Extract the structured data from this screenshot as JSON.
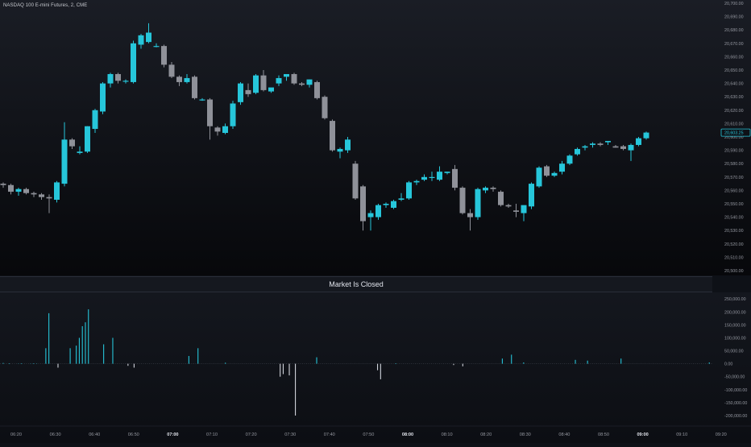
{
  "header": {
    "symbol_title": "NASDAQ 100 E-mini Futures, 2, CME"
  },
  "banner": {
    "text": "Market Is Closed"
  },
  "colors": {
    "up": "#26c6da",
    "down": "#8f9199",
    "background": "#0e1117",
    "price_tag_border": "#26c6da"
  },
  "chart_data": [
    {
      "type": "candlestick",
      "title": "",
      "ylim": [
        20500,
        20700
      ],
      "y_ticks": [
        "20,500.00",
        "20,510.00",
        "20,520.00",
        "20,530.00",
        "20,540.00",
        "20,550.00",
        "20,560.00",
        "20,570.00",
        "20,580.00",
        "20,590.00",
        "20,600.00",
        "20,610.00",
        "20,620.00",
        "20,630.00",
        "20,640.00",
        "20,650.00",
        "20,660.00",
        "20,670.00",
        "20,680.00",
        "20,690.00",
        "20,700.00"
      ],
      "last_price": 20603.25,
      "last_price_label": "20,603.25",
      "candles": [
        {
          "o": 20565,
          "h": 20566,
          "l": 20562,
          "c": 20564
        },
        {
          "o": 20564,
          "h": 20565,
          "l": 20557,
          "c": 20559
        },
        {
          "o": 20559,
          "h": 20562,
          "l": 20556,
          "c": 20561
        },
        {
          "o": 20561,
          "h": 20562,
          "l": 20557,
          "c": 20558
        },
        {
          "o": 20558,
          "h": 20559,
          "l": 20555,
          "c": 20557
        },
        {
          "o": 20557,
          "h": 20558,
          "l": 20553,
          "c": 20555
        },
        {
          "o": 20555,
          "h": 20557,
          "l": 20543,
          "c": 20554
        },
        {
          "o": 20553,
          "h": 20567,
          "l": 20551,
          "c": 20566
        },
        {
          "o": 20565,
          "h": 20611,
          "l": 20563,
          "c": 20598
        },
        {
          "o": 20598,
          "h": 20599,
          "l": 20591,
          "c": 20593
        },
        {
          "o": 20588,
          "h": 20593,
          "l": 20587,
          "c": 20589
        },
        {
          "o": 20589,
          "h": 20608,
          "l": 20588,
          "c": 20608
        },
        {
          "o": 20606,
          "h": 20621,
          "l": 20603,
          "c": 20620
        },
        {
          "o": 20619,
          "h": 20641,
          "l": 20617,
          "c": 20640
        },
        {
          "o": 20640,
          "h": 20648,
          "l": 20637,
          "c": 20647
        },
        {
          "o": 20647,
          "h": 20648,
          "l": 20640,
          "c": 20642
        },
        {
          "o": 20642,
          "h": 20643,
          "l": 20640,
          "c": 20642
        },
        {
          "o": 20641,
          "h": 20672,
          "l": 20640,
          "c": 20670
        },
        {
          "o": 20669,
          "h": 20677,
          "l": 20666,
          "c": 20676
        },
        {
          "o": 20671,
          "h": 20685,
          "l": 20670,
          "c": 20678
        },
        {
          "o": 20668,
          "h": 20670,
          "l": 20667,
          "c": 20668
        },
        {
          "o": 20668,
          "h": 20669,
          "l": 20652,
          "c": 20654
        },
        {
          "o": 20654,
          "h": 20656,
          "l": 20644,
          "c": 20645
        },
        {
          "o": 20645,
          "h": 20646,
          "l": 20638,
          "c": 20641
        },
        {
          "o": 20641,
          "h": 20647,
          "l": 20640,
          "c": 20644
        },
        {
          "o": 20645,
          "h": 20646,
          "l": 20628,
          "c": 20629
        },
        {
          "o": 20628,
          "h": 20629,
          "l": 20627,
          "c": 20628
        },
        {
          "o": 20628,
          "h": 20629,
          "l": 20598,
          "c": 20608
        },
        {
          "o": 20607,
          "h": 20608,
          "l": 20601,
          "c": 20604
        },
        {
          "o": 20603,
          "h": 20610,
          "l": 20602,
          "c": 20608
        },
        {
          "o": 20608,
          "h": 20627,
          "l": 20606,
          "c": 20625
        },
        {
          "o": 20626,
          "h": 20641,
          "l": 20624,
          "c": 20640
        },
        {
          "o": 20635,
          "h": 20640,
          "l": 20630,
          "c": 20632
        },
        {
          "o": 20633,
          "h": 20647,
          "l": 20632,
          "c": 20646
        },
        {
          "o": 20646,
          "h": 20650,
          "l": 20634,
          "c": 20635
        },
        {
          "o": 20634,
          "h": 20636,
          "l": 20633,
          "c": 20637
        },
        {
          "o": 20640,
          "h": 20646,
          "l": 20638,
          "c": 20644
        },
        {
          "o": 20645,
          "h": 20647,
          "l": 20642,
          "c": 20647
        },
        {
          "o": 20647,
          "h": 20648,
          "l": 20639,
          "c": 20640
        },
        {
          "o": 20640,
          "h": 20641,
          "l": 20638,
          "c": 20639
        },
        {
          "o": 20639,
          "h": 20643,
          "l": 20637,
          "c": 20643
        },
        {
          "o": 20641,
          "h": 20642,
          "l": 20628,
          "c": 20629
        },
        {
          "o": 20630,
          "h": 20631,
          "l": 20613,
          "c": 20614
        },
        {
          "o": 20612,
          "h": 20613,
          "l": 20589,
          "c": 20590
        },
        {
          "o": 20589,
          "h": 20592,
          "l": 20584,
          "c": 20591
        },
        {
          "o": 20590,
          "h": 20600,
          "l": 20588,
          "c": 20598
        },
        {
          "o": 20580,
          "h": 20582,
          "l": 20553,
          "c": 20554
        },
        {
          "o": 20563,
          "h": 20564,
          "l": 20530,
          "c": 20537
        },
        {
          "o": 20540,
          "h": 20545,
          "l": 20530,
          "c": 20543
        },
        {
          "o": 20540,
          "h": 20550,
          "l": 20538,
          "c": 20549
        },
        {
          "o": 20549,
          "h": 20551,
          "l": 20547,
          "c": 20550
        },
        {
          "o": 20547,
          "h": 20553,
          "l": 20546,
          "c": 20552
        },
        {
          "o": 20553,
          "h": 20558,
          "l": 20552,
          "c": 20554
        },
        {
          "o": 20554,
          "h": 20567,
          "l": 20553,
          "c": 20566
        },
        {
          "o": 20566,
          "h": 20568,
          "l": 20564,
          "c": 20567
        },
        {
          "o": 20568,
          "h": 20572,
          "l": 20567,
          "c": 20570
        },
        {
          "o": 20570,
          "h": 20574,
          "l": 20567,
          "c": 20570
        },
        {
          "o": 20568,
          "h": 20578,
          "l": 20567,
          "c": 20574
        },
        {
          "o": 20573,
          "h": 20574,
          "l": 20572,
          "c": 20574
        },
        {
          "o": 20576,
          "h": 20579,
          "l": 20560,
          "c": 20562
        },
        {
          "o": 20562,
          "h": 20563,
          "l": 20542,
          "c": 20543
        },
        {
          "o": 20543,
          "h": 20546,
          "l": 20530,
          "c": 20540
        },
        {
          "o": 20540,
          "h": 20562,
          "l": 20538,
          "c": 20561
        },
        {
          "o": 20560,
          "h": 20563,
          "l": 20558,
          "c": 20562
        },
        {
          "o": 20562,
          "h": 20563,
          "l": 20559,
          "c": 20561
        },
        {
          "o": 20559,
          "h": 20560,
          "l": 20548,
          "c": 20549
        },
        {
          "o": 20549,
          "h": 20550,
          "l": 20547,
          "c": 20548
        },
        {
          "o": 20545,
          "h": 20550,
          "l": 20540,
          "c": 20544
        },
        {
          "o": 20543,
          "h": 20545,
          "l": 20537,
          "c": 20549
        },
        {
          "o": 20548,
          "h": 20566,
          "l": 20546,
          "c": 20565
        },
        {
          "o": 20563,
          "h": 20578,
          "l": 20562,
          "c": 20577
        },
        {
          "o": 20578,
          "h": 20579,
          "l": 20570,
          "c": 20571
        },
        {
          "o": 20571,
          "h": 20574,
          "l": 20570,
          "c": 20573
        },
        {
          "o": 20574,
          "h": 20582,
          "l": 20572,
          "c": 20580
        },
        {
          "o": 20580,
          "h": 20587,
          "l": 20579,
          "c": 20586
        },
        {
          "o": 20587,
          "h": 20592,
          "l": 20586,
          "c": 20591
        },
        {
          "o": 20592,
          "h": 20594,
          "l": 20590,
          "c": 20593
        },
        {
          "o": 20594,
          "h": 20596,
          "l": 20592,
          "c": 20595
        },
        {
          "o": 20595,
          "h": 20596,
          "l": 20593,
          "c": 20594
        },
        {
          "o": 20596,
          "h": 20597,
          "l": 20594,
          "c": 20597
        },
        {
          "o": 20593,
          "h": 20594,
          "l": 20592,
          "c": 20592
        },
        {
          "o": 20593,
          "h": 20594,
          "l": 20590,
          "c": 20591
        },
        {
          "o": 20590,
          "h": 20595,
          "l": 20582,
          "c": 20594
        },
        {
          "o": 20594,
          "h": 20600,
          "l": 20593,
          "c": 20599
        },
        {
          "o": 20599,
          "h": 20604,
          "l": 20598,
          "c": 20603.25
        }
      ]
    },
    {
      "type": "bar",
      "title": "",
      "ylim": [
        -225000,
        260000
      ],
      "y_ticks": [
        "250,000.00",
        "200,000.00",
        "150,000.00",
        "100,000.00",
        "50,000.00",
        "0.00",
        "-50,000.00",
        "-100,000.00",
        "-150,000.00",
        "-200,000.00"
      ],
      "values": [
        3000,
        0,
        2000,
        0,
        0,
        1000,
        2000,
        0,
        0,
        1000,
        2000,
        1000,
        0,
        0,
        60000,
        195000,
        0,
        0,
        -15000,
        0,
        0,
        0,
        60000,
        0,
        70000,
        100000,
        145000,
        160000,
        210000,
        0,
        0,
        0,
        0,
        75000,
        0,
        0,
        100000,
        0,
        0,
        0,
        0,
        -8000,
        0,
        -15000,
        0,
        0,
        0,
        0,
        0,
        0,
        0,
        0,
        0,
        0,
        0,
        0,
        0,
        0,
        0,
        0,
        0,
        30000,
        0,
        0,
        60000,
        0,
        0,
        0,
        0,
        0,
        0,
        0,
        0,
        4000,
        0,
        0,
        0,
        0,
        0,
        0,
        0,
        0,
        0,
        0,
        0,
        0,
        0,
        0,
        0,
        0,
        0,
        -50000,
        -40000,
        0,
        -45000,
        0,
        -200000,
        0,
        0,
        0,
        0,
        0,
        0,
        25000,
        0,
        0,
        0,
        0,
        0,
        0,
        0,
        0,
        0,
        0,
        0,
        0,
        0,
        0,
        0,
        0,
        0,
        0,
        0,
        -25000,
        -60000,
        0,
        0,
        0,
        0,
        2000,
        0,
        0,
        0,
        0,
        0,
        0,
        0,
        0,
        0,
        0,
        0,
        0,
        0,
        0,
        0,
        0,
        0,
        0,
        -5000,
        0,
        0,
        -10000,
        0,
        0,
        0,
        0,
        0,
        0,
        0,
        0,
        0,
        0,
        0,
        0,
        20000,
        0,
        0,
        35000,
        0,
        0,
        0,
        5000,
        0,
        0,
        0,
        0,
        0,
        0,
        0,
        0,
        0,
        0,
        0,
        0,
        0,
        0,
        0,
        0,
        15000,
        0,
        0,
        0,
        12000,
        0,
        0,
        0,
        0,
        0,
        0,
        0,
        0,
        0,
        0,
        20000,
        0,
        0,
        0,
        0,
        0,
        0,
        0,
        0,
        0,
        0,
        0,
        0,
        0,
        0,
        0,
        0,
        0,
        0,
        0,
        0,
        0,
        0,
        0,
        0,
        0,
        0,
        0,
        0,
        5000
      ]
    }
  ],
  "x_axis": {
    "labels": [
      {
        "text": "06:20",
        "bold": false
      },
      {
        "text": "06:30",
        "bold": false
      },
      {
        "text": "06:40",
        "bold": false
      },
      {
        "text": "06:50",
        "bold": false
      },
      {
        "text": "07:00",
        "bold": true
      },
      {
        "text": "07:10",
        "bold": false
      },
      {
        "text": "07:20",
        "bold": false
      },
      {
        "text": "07:30",
        "bold": false
      },
      {
        "text": "07:40",
        "bold": false
      },
      {
        "text": "07:50",
        "bold": false
      },
      {
        "text": "08:00",
        "bold": true
      },
      {
        "text": "08:10",
        "bold": false
      },
      {
        "text": "08:20",
        "bold": false
      },
      {
        "text": "08:30",
        "bold": false
      },
      {
        "text": "08:40",
        "bold": false
      },
      {
        "text": "08:50",
        "bold": false
      },
      {
        "text": "09:00",
        "bold": true
      },
      {
        "text": "09:10",
        "bold": false
      },
      {
        "text": "09:20",
        "bold": false
      }
    ]
  }
}
